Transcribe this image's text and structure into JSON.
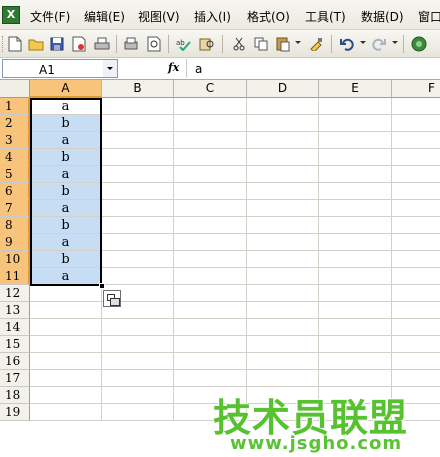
{
  "menu": {
    "app_icon": "excel-app-icon",
    "items": [
      "文件(F)",
      "编辑(E)",
      "视图(V)",
      "插入(I)",
      "格式(O)",
      "工具(T)",
      "数据(D)",
      "窗口"
    ]
  },
  "toolbar": {
    "icons": [
      "new-document-icon",
      "open-folder-icon",
      "save-icon",
      "permission-icon",
      "print-icon",
      "print-preview-icon",
      "spelling-icon",
      "research-icon",
      "cut-icon",
      "copy-icon",
      "paste-icon",
      "format-painter-icon",
      "undo-icon",
      "redo-icon",
      "hyperlink-icon"
    ]
  },
  "formula_bar": {
    "cell_reference": "A1",
    "fx_label": "fx",
    "content": "a"
  },
  "columns": [
    "A",
    "B",
    "C",
    "D",
    "E",
    "F"
  ],
  "rows": [
    "1",
    "2",
    "3",
    "4",
    "5",
    "6",
    "7",
    "8",
    "9",
    "10",
    "11",
    "12",
    "13",
    "14",
    "15",
    "16",
    "17",
    "18",
    "19"
  ],
  "cells": {
    "A": [
      "a",
      "b",
      "a",
      "b",
      "a",
      "b",
      "a",
      "b",
      "a",
      "b",
      "a"
    ]
  },
  "selection": {
    "range": "A1:A11",
    "active_cell": "A1"
  },
  "watermark": {
    "main": "技术员联盟",
    "sub": "www.jsgho.com"
  }
}
